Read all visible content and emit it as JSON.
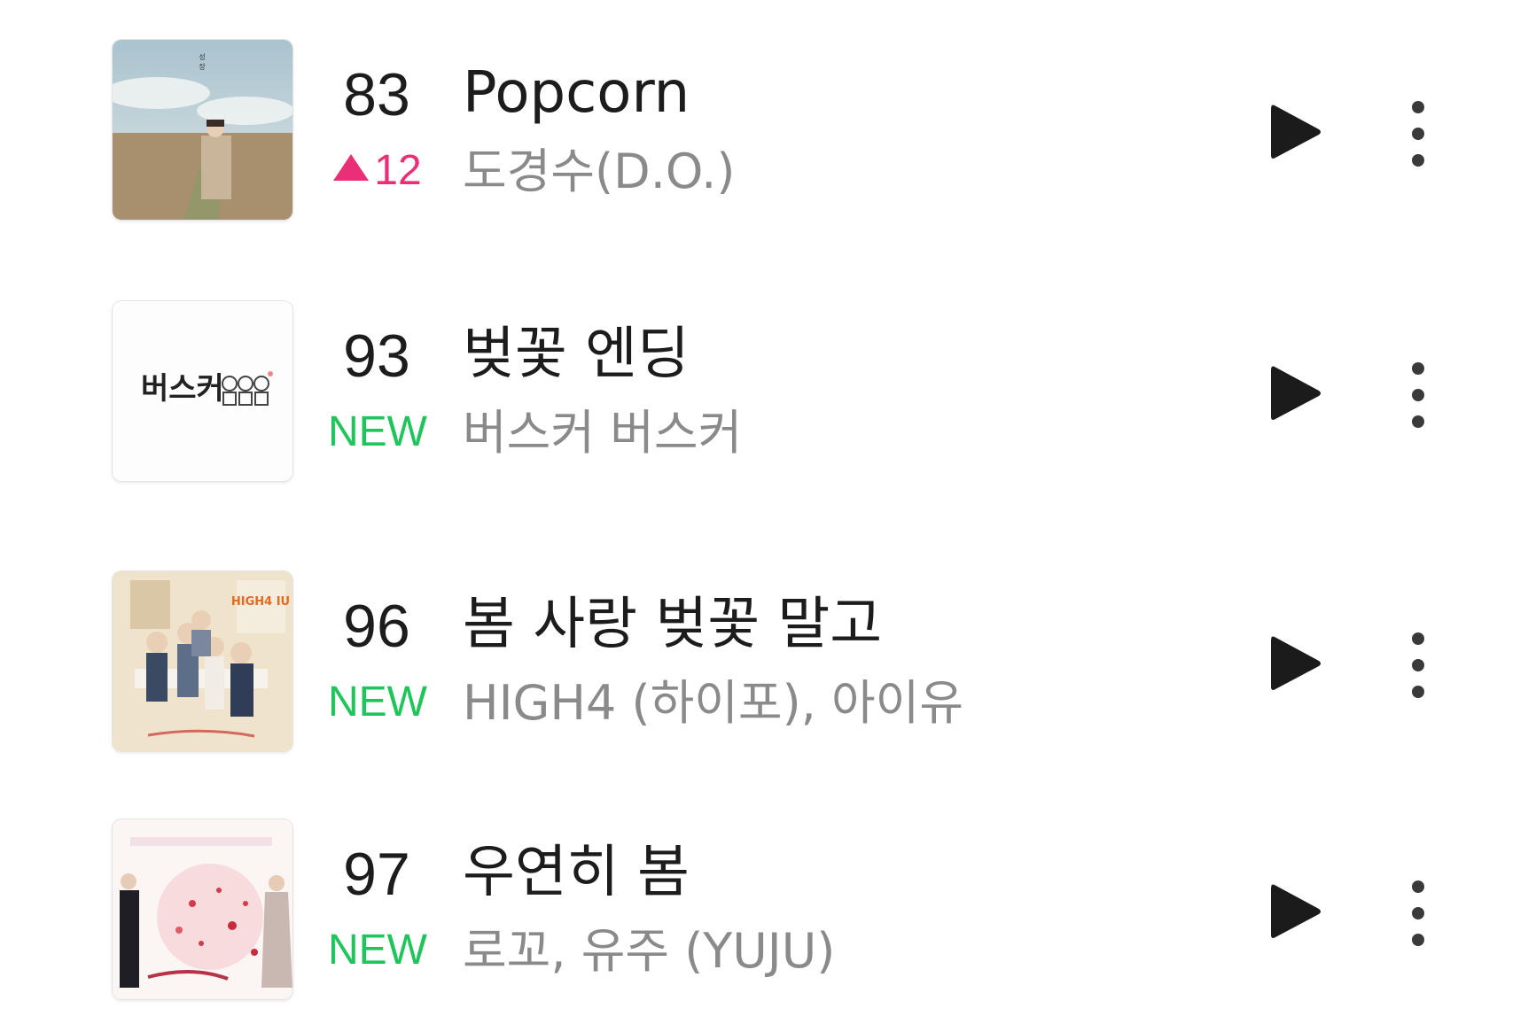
{
  "chart_list": {
    "items": [
      {
        "rank": "83",
        "change_value": "12",
        "change_status": "up",
        "title": "Popcorn",
        "artist": "도경수(D.O.)",
        "album_art_icon": "album-art-field-portrait"
      },
      {
        "rank": "93",
        "change_label": "NEW",
        "change_status": "new",
        "title": "벚꽃 엔딩",
        "artist": "버스커 버스커",
        "album_art_icon": "album-art-busker-logo",
        "album_art_logo_text": "버스커"
      },
      {
        "rank": "96",
        "change_label": "NEW",
        "change_status": "new",
        "title": "봄 사랑 벚꽃 말고",
        "artist": "HIGH4 (하이포), 아이유",
        "album_art_icon": "album-art-group-photo",
        "album_art_logo_text": "HIGH4 IU"
      },
      {
        "rank": "97",
        "change_label": "NEW",
        "change_status": "new",
        "title": "우연히 봄",
        "artist": "로꼬, 유주 (YUJU)",
        "album_art_icon": "album-art-blossom-couple"
      }
    ]
  },
  "colors": {
    "new_badge": "#1fc55a",
    "rank_up": "#ea2f76",
    "title_text": "#1c1c1c",
    "artist_text": "#8a8a8a"
  },
  "icons": {
    "play": "play-icon",
    "more": "more-vertical-icon"
  }
}
